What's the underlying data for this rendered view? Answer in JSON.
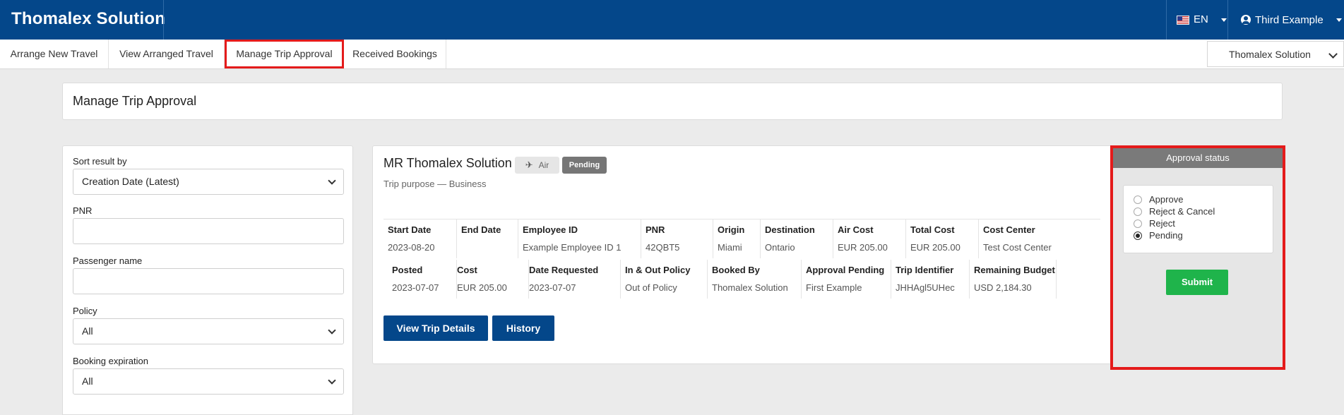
{
  "header": {
    "brand": "Thomalex Solution",
    "language": "EN",
    "user_name": "Third Example"
  },
  "nav": {
    "tabs": [
      {
        "label": "Arrange New Travel"
      },
      {
        "label": "View Arranged Travel"
      },
      {
        "label": "Manage Trip Approval",
        "highlighted": true
      },
      {
        "label": "Received Bookings"
      }
    ],
    "company_select": "Thomalex Solution"
  },
  "page": {
    "title": "Manage Trip Approval"
  },
  "filters": {
    "sort_label": "Sort result by",
    "sort_value": "Creation Date (Latest)",
    "pnr_label": "PNR",
    "pnr_value": "",
    "passenger_label": "Passenger name",
    "passenger_value": "",
    "policy_label": "Policy",
    "policy_value": "All",
    "expiration_label": "Booking expiration",
    "expiration_value": "All"
  },
  "trip": {
    "passenger": "MR Thomalex Solution",
    "mode": "Air",
    "status": "Pending",
    "purpose": "Trip purpose — Business",
    "row1": [
      {
        "label": "Start Date",
        "value": "2023-08-20"
      },
      {
        "label": "End Date",
        "value": ""
      },
      {
        "label": "Employee ID",
        "value": "Example Employee ID 1"
      },
      {
        "label": "PNR",
        "value": "42QBT5"
      },
      {
        "label": "Origin",
        "value": "Miami"
      },
      {
        "label": "Destination",
        "value": "Ontario"
      },
      {
        "label": "Air Cost",
        "value": "EUR 205.00"
      },
      {
        "label": "Total Cost",
        "value": "EUR 205.00"
      },
      {
        "label": "Cost Center",
        "value": "Test Cost Center"
      }
    ],
    "row2": [
      {
        "label": "Posted",
        "value": "2023-07-07"
      },
      {
        "label": "Cost",
        "value": "EUR 205.00"
      },
      {
        "label": "Date Requested",
        "value": "2023-07-07"
      },
      {
        "label": "In & Out Policy",
        "value": "Out of Policy"
      },
      {
        "label": "Booked By",
        "value": "Thomalex Solution"
      },
      {
        "label": "Approval Pending",
        "value": "First Example"
      },
      {
        "label": "Trip Identifier",
        "value": "JHHAgl5UHec"
      },
      {
        "label": "Remaining Budget",
        "value": "USD 2,184.30"
      }
    ],
    "view_details_button": "View Trip Details",
    "history_button": "History"
  },
  "approval": {
    "title": "Approval status",
    "options": [
      {
        "label": "Approve",
        "checked": false
      },
      {
        "label": "Reject & Cancel",
        "checked": false
      },
      {
        "label": "Reject",
        "checked": false
      },
      {
        "label": "Pending",
        "checked": true
      }
    ],
    "submit_label": "Submit"
  },
  "colors": {
    "brand": "#04478a",
    "highlight": "#e41b1b",
    "submit": "#1fb44b",
    "pending_badge": "#767676"
  }
}
